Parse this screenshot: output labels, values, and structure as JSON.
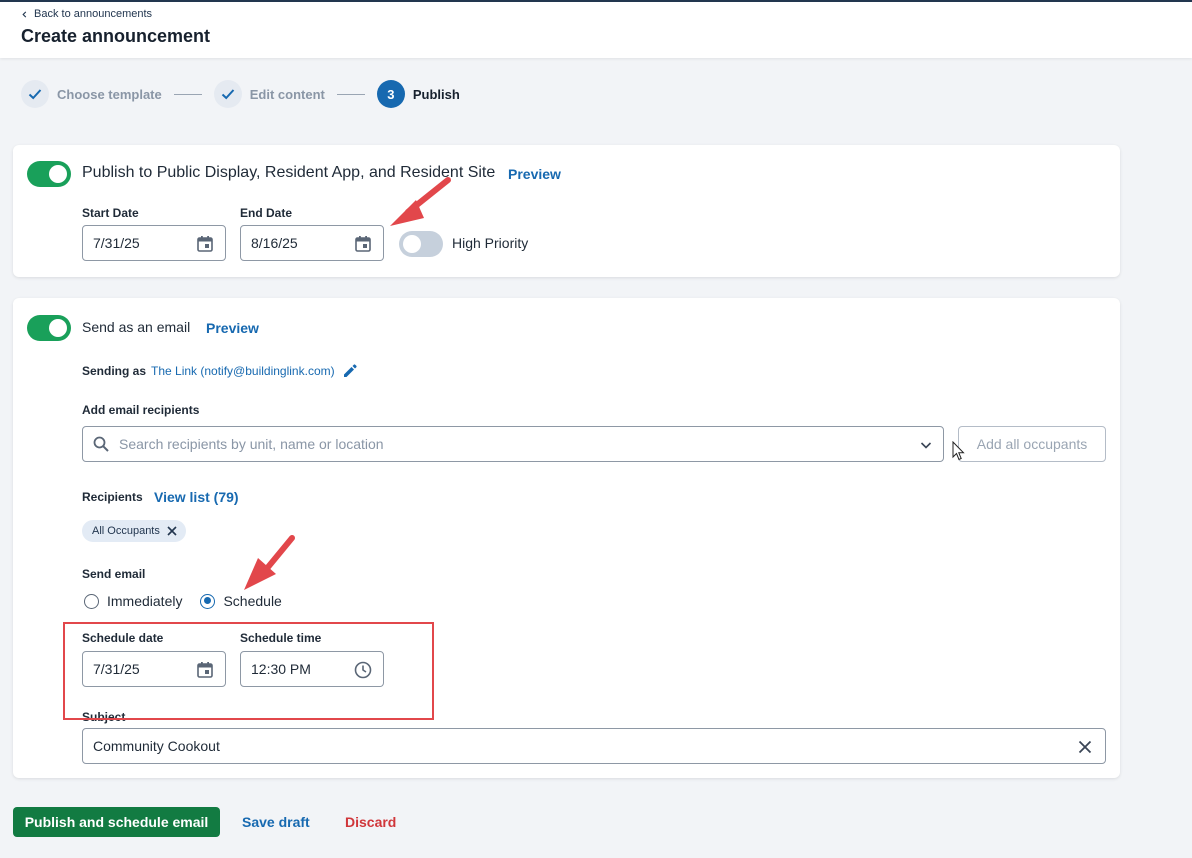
{
  "header": {
    "back_label": "Back to announcements",
    "title": "Create announcement"
  },
  "stepper": {
    "steps": [
      {
        "label": "Choose template",
        "state": "done"
      },
      {
        "label": "Edit content",
        "state": "done"
      },
      {
        "label": "Publish",
        "state": "active",
        "number": "3"
      }
    ]
  },
  "publish_card": {
    "title": "Publish to Public Display, Resident App, and Resident Site",
    "preview_label": "Preview",
    "enabled": true,
    "start_date_label": "Start Date",
    "start_date_value": "7/31/25",
    "end_date_label": "End Date",
    "end_date_value": "8/16/25",
    "high_priority_label": "High Priority",
    "high_priority_enabled": false
  },
  "email_card": {
    "title": "Send as an email",
    "preview_label": "Preview",
    "enabled": true,
    "sending_as_label": "Sending as",
    "sending_as_value": "The Link (notify@buildinglink.com)",
    "add_recipients_label": "Add email recipients",
    "search_placeholder": "Search recipients by unit, name or location",
    "add_all_label": "Add all occupants",
    "recipients_label": "Recipients",
    "view_list_label": "View list (79)",
    "chips": [
      "All Occupants"
    ],
    "send_email_label": "Send email",
    "radio_options": [
      {
        "label": "Immediately",
        "checked": false
      },
      {
        "label": "Schedule",
        "checked": true
      }
    ],
    "schedule_date_label": "Schedule date",
    "schedule_date_value": "7/31/25",
    "schedule_time_label": "Schedule time",
    "schedule_time_value": "12:30 PM",
    "subject_label": "Subject",
    "subject_value": "Community Cookout"
  },
  "footer": {
    "primary_label": "Publish and schedule email",
    "save_draft_label": "Save draft",
    "discard_label": "Discard"
  },
  "colors": {
    "accent": "#1769b0",
    "toggle_on": "#19a05a",
    "primary_button": "#127b42",
    "discard": "#d0363a",
    "annotation": "#e2474b"
  }
}
